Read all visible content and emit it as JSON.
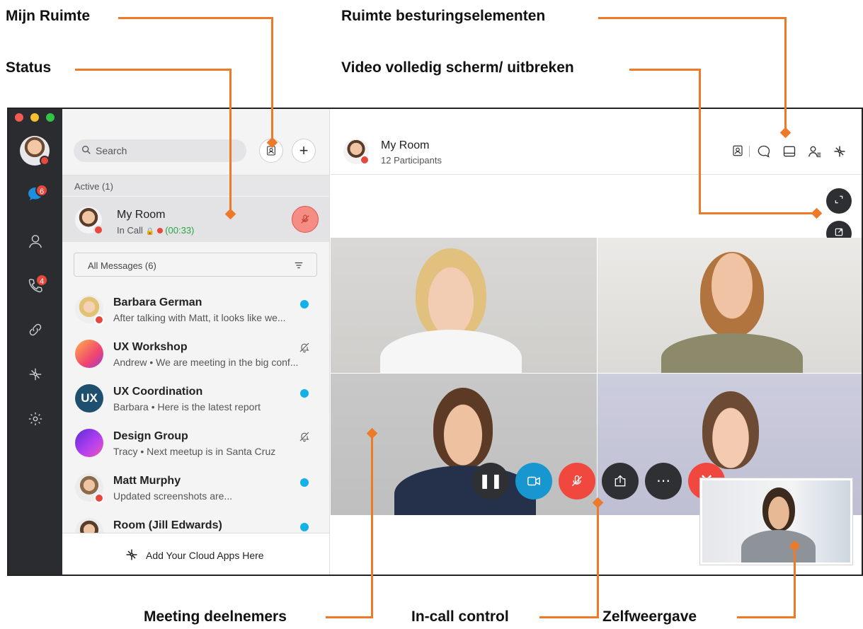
{
  "callouts": {
    "my_space": "Mijn Ruimte",
    "status": "Status",
    "space_controls": "Ruimte besturingselementen",
    "video_fullscreen": "Video volledig scherm/ uitbreken",
    "meeting_participants": "Meeting deelnemers",
    "in_call_control": "In-call control",
    "self_view": "Zelfweergave"
  },
  "sidebar": {
    "messages_badge": "6",
    "calls_badge": "4"
  },
  "list": {
    "search_placeholder": "Search",
    "active_header": "Active (1)",
    "active_room": {
      "name": "My Room",
      "status_prefix": "In Call",
      "timer": "(00:33)"
    },
    "filter_label": "All Messages (6)",
    "items": [
      {
        "name": "Barbara German",
        "preview": "After talking with Matt, it looks like we...",
        "unread": true
      },
      {
        "name": "UX Workshop",
        "preview": "Andrew • We are meeting in the big conf...",
        "muted": true
      },
      {
        "name": "UX Coordination",
        "preview": "Barbara • Here is the latest report",
        "unread": true,
        "avatar_text": "UX"
      },
      {
        "name": "Design Group",
        "preview": "Tracy • Next meetup is in Santa Cruz",
        "muted": true
      },
      {
        "name": "Matt Murphy",
        "preview": "Updated screenshots are...",
        "unread": true
      },
      {
        "name": "Room (Jill Edwards)",
        "preview": "",
        "unread": true
      }
    ],
    "footer_label": "Add Your Cloud Apps Here"
  },
  "header": {
    "room_title": "My Room",
    "participants": "12 Participants"
  },
  "colors": {
    "accent_orange": "#ec7a29",
    "rail_bg": "#2b2c30",
    "unread_blue": "#15b0e8",
    "end_red": "#f0483e",
    "video_blue": "#1796d0"
  }
}
